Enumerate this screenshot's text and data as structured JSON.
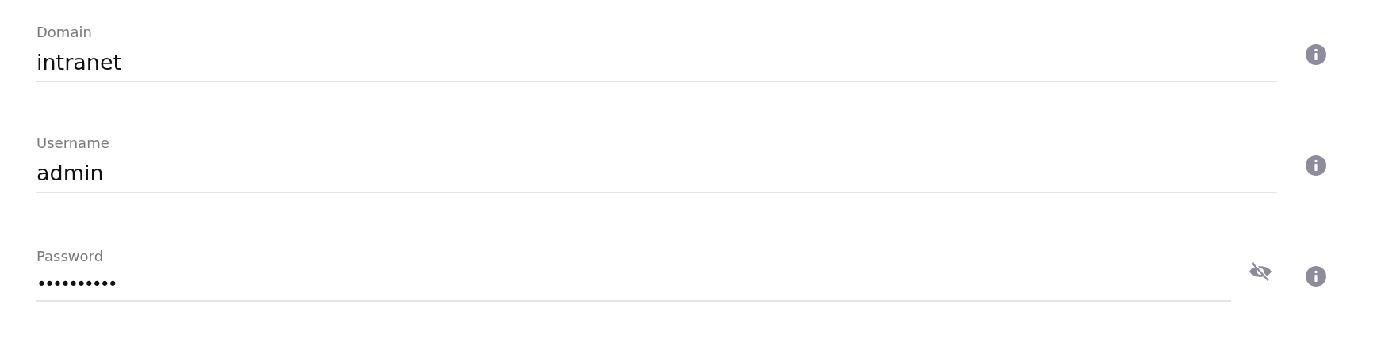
{
  "fields": [
    {
      "kind": "text",
      "label": "Domain",
      "value": "intranet"
    },
    {
      "kind": "text",
      "label": "Username",
      "value": "admin"
    },
    {
      "kind": "password",
      "label": "Password",
      "value": "••••••••••",
      "revealed": false
    }
  ]
}
